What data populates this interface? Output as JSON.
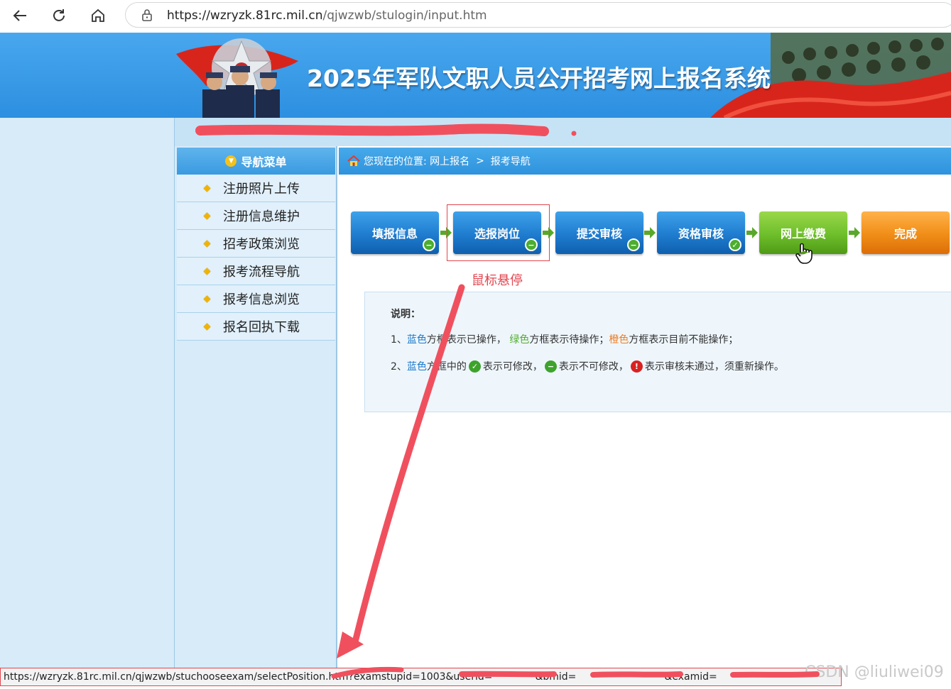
{
  "browser": {
    "url_host": "https://wzryzk.81rc.mil.cn",
    "url_path": "/qjwzwb/stulogin/input.htm"
  },
  "banner": {
    "title": "2025年军队文职人员公开招考网上报名系统"
  },
  "sidebar": {
    "header": "导航菜单",
    "items": [
      {
        "label": "注册照片上传"
      },
      {
        "label": "注册信息维护"
      },
      {
        "label": "招考政策浏览"
      },
      {
        "label": "报考流程导航"
      },
      {
        "label": "报考信息浏览"
      },
      {
        "label": "报名回执下载"
      }
    ]
  },
  "breadcrumb": {
    "prefix": "您现在的位置:",
    "level1": "网上报名",
    "separator": ">",
    "level2": "报考导航"
  },
  "steps": [
    {
      "label": "填报信息",
      "color": "blue",
      "badge": "minus"
    },
    {
      "label": "选报岗位",
      "color": "blue",
      "badge": "minus"
    },
    {
      "label": "提交审核",
      "color": "blue",
      "badge": "minus"
    },
    {
      "label": "资格审核",
      "color": "blue",
      "badge": "check"
    },
    {
      "label": "网上缴费",
      "color": "green",
      "badge": ""
    },
    {
      "label": "完成",
      "color": "orange",
      "badge": ""
    }
  ],
  "annotation": {
    "hover_note": "鼠标悬停"
  },
  "explain": {
    "title": "说明：",
    "line1": {
      "num": "1、",
      "blue": "蓝色",
      "t1": "方框表示已操作，",
      "green": "绿色",
      "t2": "方框表示待操作；",
      "orange": "橙色",
      "t3": "方框表示目前不能操作；"
    },
    "line2": {
      "num": "2、",
      "blue": "蓝色",
      "t1": "方框中的",
      "t2": "表示可修改，",
      "t3": "表示不可修改，",
      "t4": "表示审核未通过，须重新操作。"
    }
  },
  "statusbar": {
    "text": "https://wzryzk.81rc.mil.cn/qjwzwb/stuchooseexam/selectPosition.htm?examstupid=1003&userid=",
    "part2": "&bmid=",
    "part3": "&examid="
  },
  "watermark": "CSDN @liuliwei09",
  "colors": {
    "accent_blue": "#2f93dd",
    "step_green": "#6ebe2b",
    "step_orange": "#f08d17",
    "annotation_red": "#e2464f"
  }
}
